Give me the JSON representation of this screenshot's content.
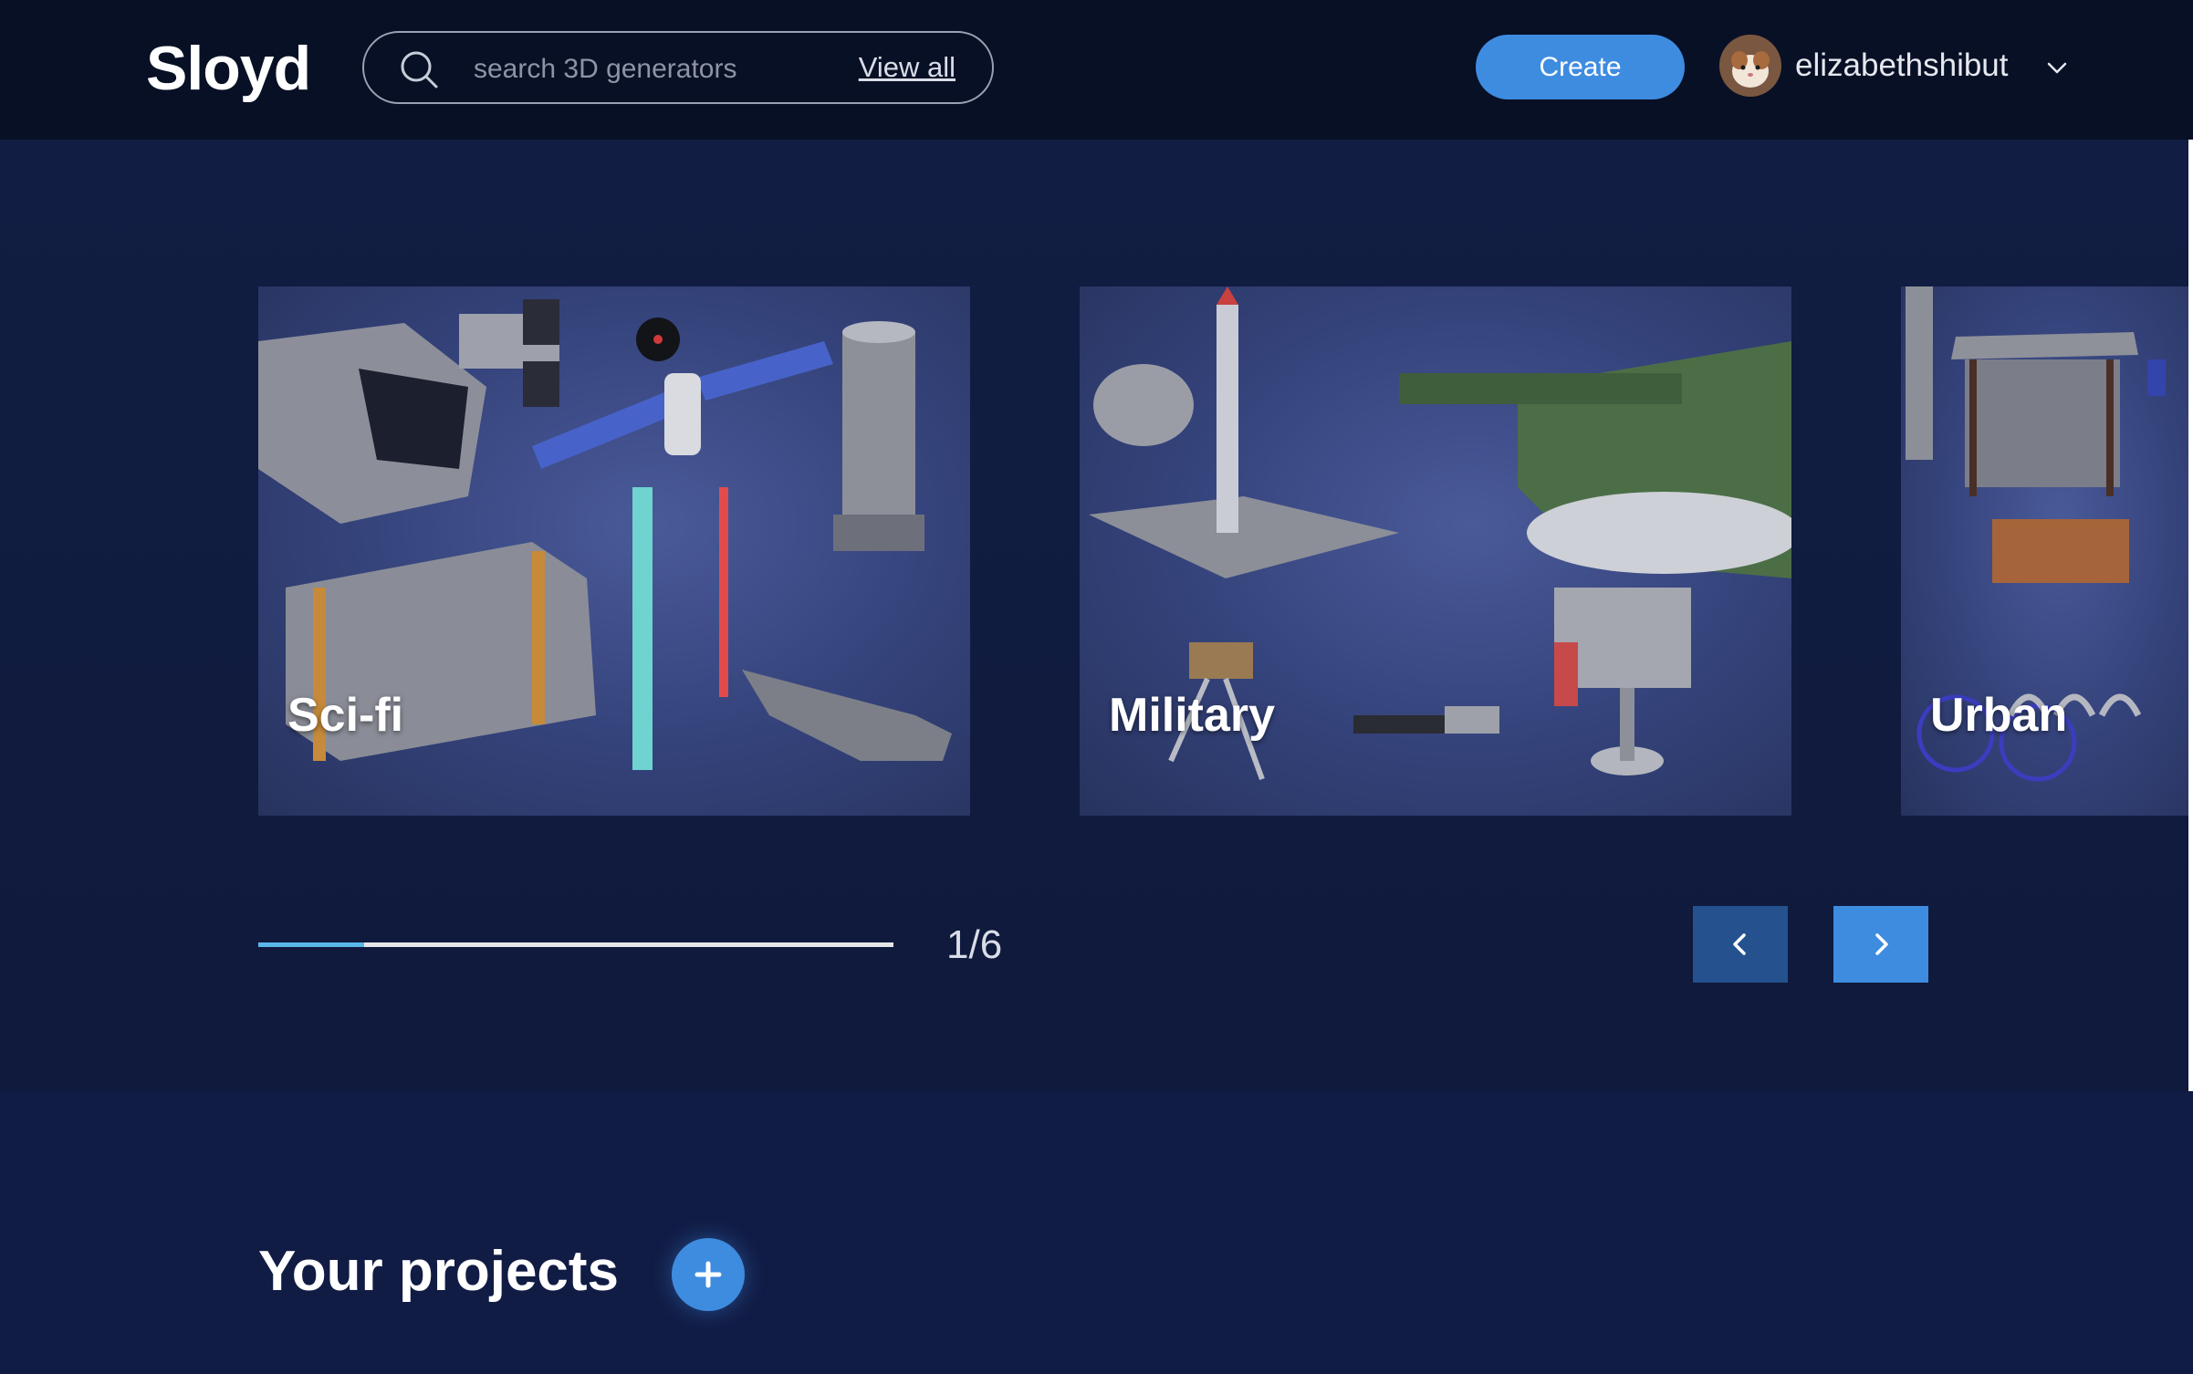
{
  "header": {
    "logo": "Sloyd",
    "search": {
      "placeholder": "search 3D generators",
      "view_all": "View all"
    },
    "create_label": "Create",
    "username": "elizabethshibut"
  },
  "carousel": {
    "cards": [
      {
        "title": "Sci-fi"
      },
      {
        "title": "Military"
      },
      {
        "title": "Urban"
      }
    ],
    "counter": "1/6",
    "progress_fraction": 0.1667
  },
  "projects": {
    "title": "Your projects"
  },
  "colors": {
    "accent": "#3e8ce0",
    "header_bg": "#081025",
    "page_bg": "#0d1733",
    "progress": "#59b8e8"
  }
}
